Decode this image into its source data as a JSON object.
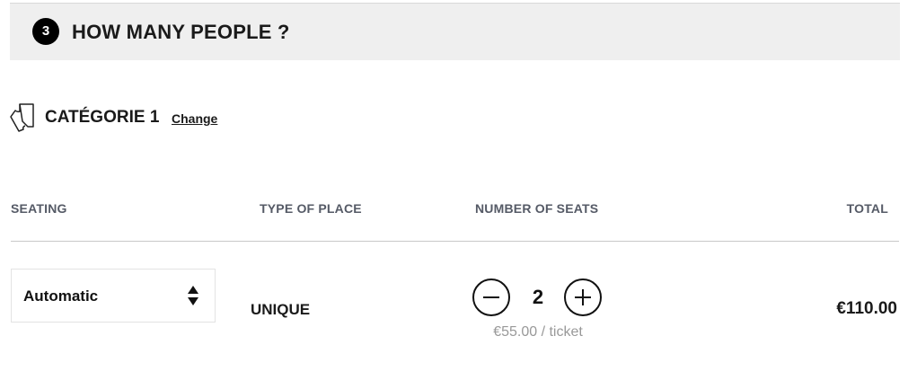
{
  "step": {
    "number": "3",
    "title": "HOW MANY PEOPLE ?"
  },
  "category": {
    "icon": "ticket-icon",
    "label": "CATÉGORIE 1",
    "change_label": "Change"
  },
  "table": {
    "headers": {
      "seating": "SEATING",
      "type_of_place": "TYPE OF PLACE",
      "number_of_seats": "NUMBER OF SEATS",
      "total": "TOTAL"
    },
    "row": {
      "seating_value": "Automatic",
      "type_of_place": "UNIQUE",
      "seats": "2",
      "unit_price": "€55.00 / ticket",
      "total": "€110.00"
    }
  },
  "icons": {
    "decrease": "minus-icon",
    "increase": "plus-icon",
    "select": "sort-arrows-icon"
  }
}
